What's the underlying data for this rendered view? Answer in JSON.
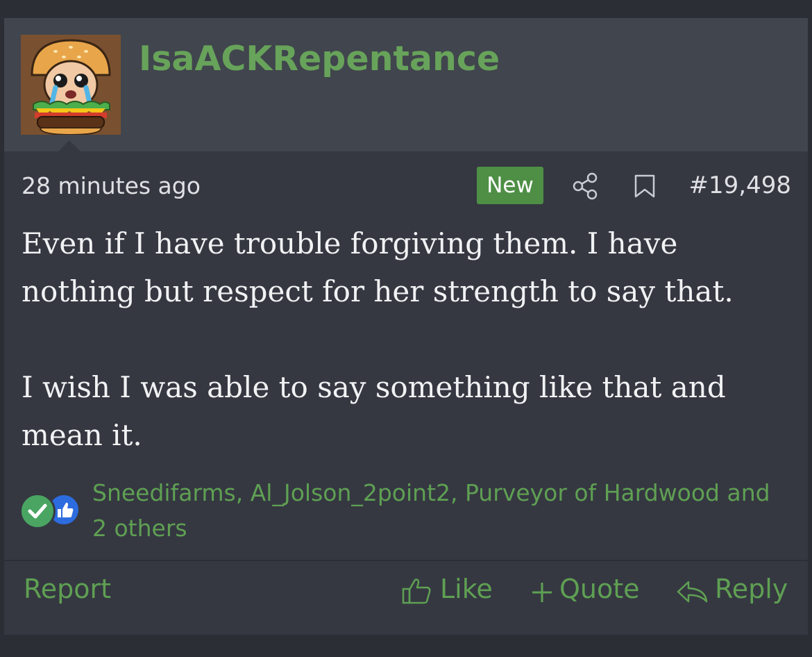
{
  "post": {
    "username": "IsaACKRepentance",
    "avatar_icon": "crying-burger-avatar",
    "timestamp": "28 minutes ago",
    "badge": "New",
    "post_number": "#19,498",
    "body": [
      "Even if I have trouble forgiving them. I have nothing but respect for her strength to say that.",
      "I wish I was able to say something like that and mean it."
    ],
    "reactions": {
      "icons": [
        "check-reaction-icon",
        "thumbs-up-reaction-icon"
      ],
      "users_text": "Sneedifarms, Al_Jolson_2point2, Purveyor of Hardwood and 2 others"
    },
    "footer": {
      "report": "Report",
      "like": "Like",
      "quote": "Quote",
      "reply": "Reply"
    }
  },
  "colors": {
    "accent_green": "#5fa053",
    "badge_green": "#4e8f45",
    "header_bg": "#41454d",
    "post_bg": "#353841"
  }
}
